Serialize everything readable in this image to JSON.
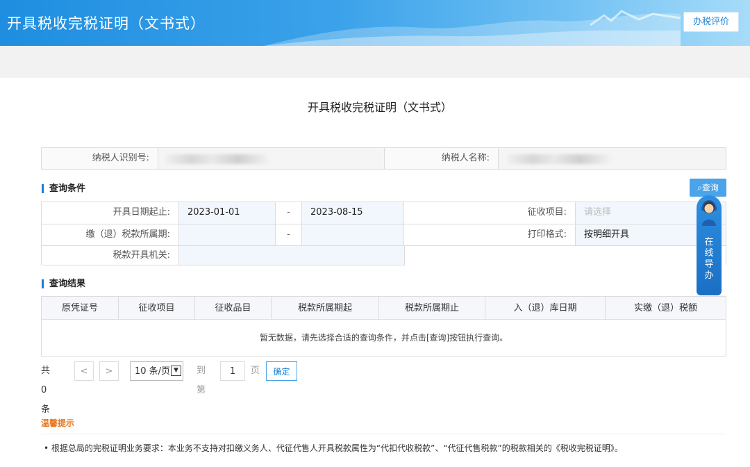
{
  "header": {
    "title": "开具税收完税证明（文书式）",
    "eval_button": "办税评价",
    "accent": "#1f8ee0"
  },
  "page_title": "开具税收完税证明（文书式）",
  "taxpayer": {
    "id_label": "纳税人识别号:",
    "name_label": "纳税人名称:"
  },
  "query_section": {
    "title": "查询条件",
    "query_button": "查询",
    "query_icon": "search-icon",
    "fields": {
      "issue_date_label": "开具日期起止:",
      "issue_date_start": "2023-01-01",
      "issue_date_end": "2023-08-15",
      "dash": "-",
      "levy_item_label": "征收项目:",
      "levy_item_placeholder": "请选择",
      "period_label": "缴（退）税款所属期:",
      "print_format_label": "打印格式:",
      "print_format_value": "按明细开具",
      "office_label": "税款开具机关:"
    }
  },
  "result_section": {
    "title": "查询结果",
    "columns": [
      "原凭证号",
      "征收项目",
      "征收品目",
      "税款所属期起",
      "税款所属期止",
      "入（退）库日期",
      "实缴（退）税额"
    ],
    "empty_text": "暂无数据，请先选择合适的查询条件，并点击[查询]按钮执行查询。"
  },
  "pager": {
    "total": "共 0 条",
    "prev": "<",
    "next": ">",
    "page_size": "10 条/页",
    "goto_label": "到第",
    "page_value": "1",
    "page_unit": "页",
    "confirm": "确定"
  },
  "tips": {
    "title": "温馨提示",
    "text": "• 根据总局的完税证明业务要求：本业务不支持对扣缴义务人、代征代售人开具税款属性为“代扣代收税款”、“代征代售税款”的税款相关的《税收完税证明》。"
  },
  "guide": {
    "text": [
      "在",
      "线",
      "导",
      "办"
    ]
  }
}
